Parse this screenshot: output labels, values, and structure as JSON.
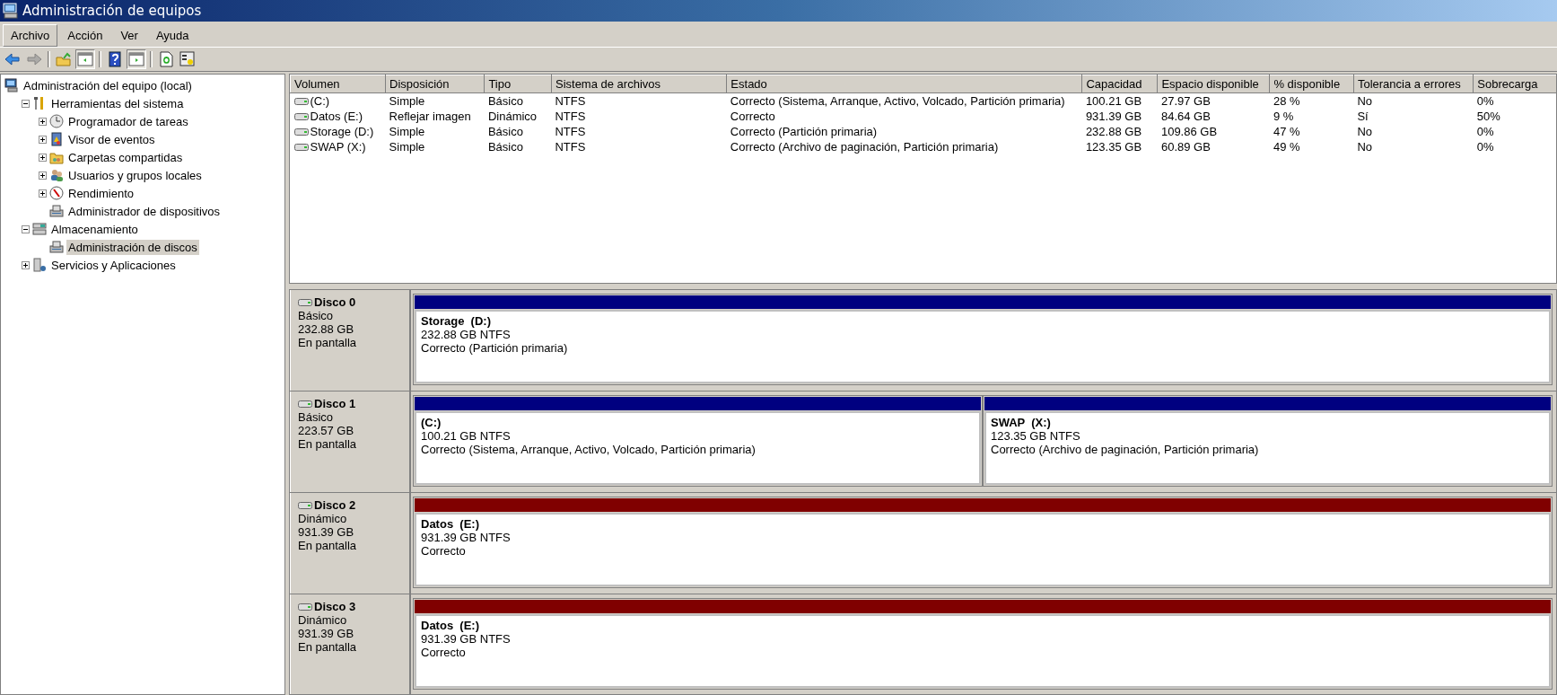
{
  "window": {
    "title": "Administración de equipos"
  },
  "menu": [
    {
      "label": "Archivo",
      "selected": true
    },
    {
      "label": "Acción",
      "selected": false
    },
    {
      "label": "Ver",
      "selected": false
    },
    {
      "label": "Ayuda",
      "selected": false
    }
  ],
  "toolbar": [
    {
      "kind": "back",
      "pressed": false,
      "disabled": false
    },
    {
      "kind": "forward",
      "pressed": false,
      "disabled": true
    },
    {
      "kind": "sep"
    },
    {
      "kind": "up",
      "pressed": false,
      "disabled": false
    },
    {
      "kind": "tree",
      "pressed": true,
      "disabled": false
    },
    {
      "kind": "sep"
    },
    {
      "kind": "help",
      "pressed": false,
      "disabled": false
    },
    {
      "kind": "pane",
      "pressed": true,
      "disabled": false
    },
    {
      "kind": "sep"
    },
    {
      "kind": "refresh",
      "pressed": false,
      "disabled": false
    },
    {
      "kind": "props",
      "pressed": false,
      "disabled": false
    }
  ],
  "tree": [
    {
      "label": "Administración del equipo (local)",
      "kind": "computer",
      "selected": false,
      "children": [
        {
          "label": "Herramientas del sistema",
          "kind": "tools",
          "expanded": true,
          "selected": false,
          "children": [
            {
              "label": "Programador de tareas",
              "kind": "clock",
              "expanded": false,
              "selected": false
            },
            {
              "label": "Visor de eventos",
              "kind": "log",
              "expanded": false,
              "selected": false
            },
            {
              "label": "Carpetas compartidas",
              "kind": "folder",
              "expanded": false,
              "selected": false
            },
            {
              "label": "Usuarios y grupos locales",
              "kind": "users",
              "expanded": false,
              "selected": false
            },
            {
              "label": "Rendimiento",
              "kind": "gauge",
              "expanded": false,
              "selected": false
            },
            {
              "label": "Administrador de dispositivos",
              "kind": "device",
              "selected": false
            }
          ]
        },
        {
          "label": "Almacenamiento",
          "kind": "storage",
          "expanded": true,
          "selected": false,
          "children": [
            {
              "label": "Administración de discos",
              "kind": "device",
              "selected": true
            }
          ]
        },
        {
          "label": "Servicios y Aplicaciones",
          "kind": "services",
          "expanded": false,
          "selected": false
        }
      ]
    }
  ],
  "table": {
    "columns": [
      "Volumen",
      "Disposición",
      "Tipo",
      "Sistema de archivos",
      "Estado",
      "Capacidad",
      "Espacio disponible",
      "% disponible",
      "Tolerancia a errores",
      "Sobrecarga"
    ],
    "rows": [
      [
        "(C:)",
        "Simple",
        "Básico",
        "NTFS",
        "Correcto (Sistema, Arranque, Activo, Volcado, Partición primaria)",
        "100.21 GB",
        "27.97 GB",
        "28 %",
        "No",
        "0%"
      ],
      [
        "Datos (E:)",
        "Reflejar imagen",
        "Dinámico",
        "NTFS",
        "Correcto",
        "931.39 GB",
        "84.64 GB",
        "9 %",
        "Sí",
        "50%"
      ],
      [
        "Storage (D:)",
        "Simple",
        "Básico",
        "NTFS",
        "Correcto (Partición primaria)",
        "232.88 GB",
        "109.86 GB",
        "47 %",
        "No",
        "0%"
      ],
      [
        "SWAP (X:)",
        "Simple",
        "Básico",
        "NTFS",
        "Correcto (Archivo de paginación, Partición primaria)",
        "123.35 GB",
        "60.89 GB",
        "49 %",
        "No",
        "0%"
      ]
    ]
  },
  "disks": [
    {
      "name": "Disco 0",
      "type": "Básico",
      "size": "232.88 GB",
      "status": "En pantalla",
      "partitions": [
        {
          "name": "Storage  (D:)",
          "size": "232.88 GB NTFS",
          "status": "Correcto (Partición primaria)",
          "color": "#000080"
        }
      ]
    },
    {
      "name": "Disco 1",
      "type": "Básico",
      "size": "223.57 GB",
      "status": "En pantalla",
      "partitions": [
        {
          "name": "(C:)",
          "size": "100.21 GB NTFS",
          "status": "Correcto (Sistema, Arranque, Activo, Volcado, Partición primaria)",
          "color": "#000080"
        },
        {
          "name": "SWAP  (X:)",
          "size": "123.35 GB NTFS",
          "status": "Correcto (Archivo de paginación, Partición primaria)",
          "color": "#000080"
        }
      ]
    },
    {
      "name": "Disco 2",
      "type": "Dinámico",
      "size": "931.39 GB",
      "status": "En pantalla",
      "partitions": [
        {
          "name": "Datos  (E:)",
          "size": "931.39 GB NTFS",
          "status": "Correcto",
          "color": "#800000"
        }
      ]
    },
    {
      "name": "Disco 3",
      "type": "Dinámico",
      "size": "931.39 GB",
      "status": "En pantalla",
      "partitions": [
        {
          "name": "Datos  (E:)",
          "size": "931.39 GB NTFS",
          "status": "Correcto",
          "color": "#800000"
        }
      ]
    }
  ]
}
